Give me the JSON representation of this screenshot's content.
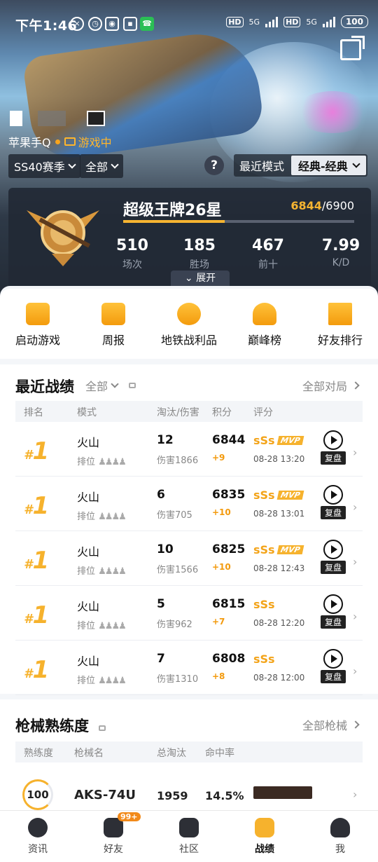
{
  "status": {
    "time": "下午1:46",
    "battery": "100",
    "net1": "HD",
    "net2": "5G"
  },
  "profile": {
    "name": "苹果手Q",
    "status": "游戏中"
  },
  "filters": {
    "season": "SS40赛季",
    "scope": "全部",
    "mode_label": "最近模式",
    "mode_value": "经典-经典",
    "help": "?"
  },
  "rank": {
    "title": "超级王牌26星",
    "points": "6844",
    "max": "/6900",
    "progress": 0.44,
    "stats": [
      {
        "value": "510",
        "label": "场次"
      },
      {
        "value": "185",
        "label": "胜场"
      },
      {
        "value": "467",
        "label": "前十"
      },
      {
        "value": "7.99",
        "label": "K/D"
      }
    ],
    "expand": "展开"
  },
  "quick": [
    {
      "label": "启动游戏",
      "icon": "lightning-icon"
    },
    {
      "label": "周报",
      "icon": "calendar-icon"
    },
    {
      "label": "地铁战利品",
      "icon": "loot-icon"
    },
    {
      "label": "巅峰榜",
      "icon": "trophy-icon"
    },
    {
      "label": "好友排行",
      "icon": "podium-icon"
    }
  ],
  "recent": {
    "title": "最近战绩",
    "filter": "全部",
    "more": "全部对局",
    "headers": [
      "排名",
      "模式",
      "淘汰/伤害",
      "积分",
      "评分"
    ],
    "rows": [
      {
        "rank": "1",
        "map": "火山",
        "type": "排位",
        "kills": "12",
        "damage": "伤害1866",
        "score": "6844",
        "delta": "+9",
        "grade": "sSs",
        "mvp": "MVP",
        "date": "08-28 13:20",
        "replay": "复盘"
      },
      {
        "rank": "1",
        "map": "火山",
        "type": "排位",
        "kills": "6",
        "damage": "伤害705",
        "score": "6835",
        "delta": "+10",
        "grade": "sSs",
        "mvp": "MVP",
        "date": "08-28 13:01",
        "replay": "复盘"
      },
      {
        "rank": "1",
        "map": "火山",
        "type": "排位",
        "kills": "10",
        "damage": "伤害1566",
        "score": "6825",
        "delta": "+10",
        "grade": "sSs",
        "mvp": "MVP",
        "date": "08-28 12:43",
        "replay": "复盘"
      },
      {
        "rank": "1",
        "map": "火山",
        "type": "排位",
        "kills": "5",
        "damage": "伤害962",
        "score": "6815",
        "delta": "+7",
        "grade": "sSs",
        "mvp": "",
        "date": "08-28 12:20",
        "replay": "复盘"
      },
      {
        "rank": "1",
        "map": "火山",
        "type": "排位",
        "kills": "7",
        "damage": "伤害1310",
        "score": "6808",
        "delta": "+8",
        "grade": "sSs",
        "mvp": "",
        "date": "08-28 12:00",
        "replay": "复盘"
      }
    ]
  },
  "guns": {
    "title": "枪械熟练度",
    "more": "全部枪械",
    "headers": [
      "熟练度",
      "枪械名",
      "总淘汰",
      "命中率"
    ],
    "row": {
      "level": "100",
      "name": "AKS-74U",
      "kills": "1959",
      "acc": "14.5%"
    }
  },
  "tabs": [
    {
      "label": "资讯"
    },
    {
      "label": "好友",
      "badge": "99+"
    },
    {
      "label": "社区"
    },
    {
      "label": "战绩"
    },
    {
      "label": "我"
    }
  ]
}
